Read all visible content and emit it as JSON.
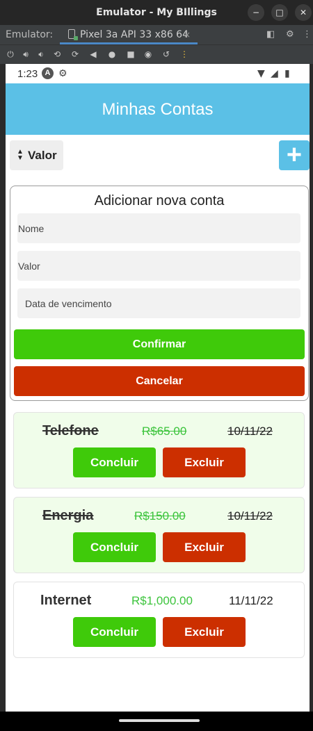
{
  "window": {
    "title": "Emulator - My BIllings"
  },
  "tabbar": {
    "label": "Emulator:",
    "tab_label": "Pixel 3a API 33 x86 64",
    "tab_close": "×"
  },
  "toolbar": {
    "icons": [
      "power-icon",
      "volume-up-icon",
      "volume-down-icon",
      "rotate-left-icon",
      "rotate-right-icon",
      "back-icon",
      "home-icon",
      "overview-icon",
      "camera-icon",
      "reset-icon",
      "more-icon"
    ]
  },
  "status": {
    "time": "1:23",
    "a_badge": "A"
  },
  "app": {
    "title": "Minhas Contas",
    "sort_label": "Valor",
    "add_symbol": "+",
    "colors": {
      "header": "#5bc0e6",
      "confirm": "#3fca0a",
      "cancel": "#cc2f00",
      "value_text": "#3cc43c",
      "card_done_bg": "#f0fdea"
    }
  },
  "form": {
    "title": "Adicionar nova conta",
    "name_placeholder": "Nome",
    "value_placeholder": "Valor",
    "date_placeholder": "Data de vencimento",
    "confirm_label": "Confirmar",
    "cancel_label": "Cancelar"
  },
  "bills": [
    {
      "name": "Telefone",
      "value": "R$65.00",
      "date": "10/11/22",
      "done": true,
      "complete_label": "Concluir",
      "delete_label": "Excluir"
    },
    {
      "name": "Energia",
      "value": "R$150.00",
      "date": "10/11/22",
      "done": true,
      "complete_label": "Concluir",
      "delete_label": "Excluir"
    },
    {
      "name": "Internet",
      "value": "R$1,000.00",
      "date": "11/11/22",
      "done": false,
      "complete_label": "Concluir",
      "delete_label": "Excluir"
    }
  ]
}
